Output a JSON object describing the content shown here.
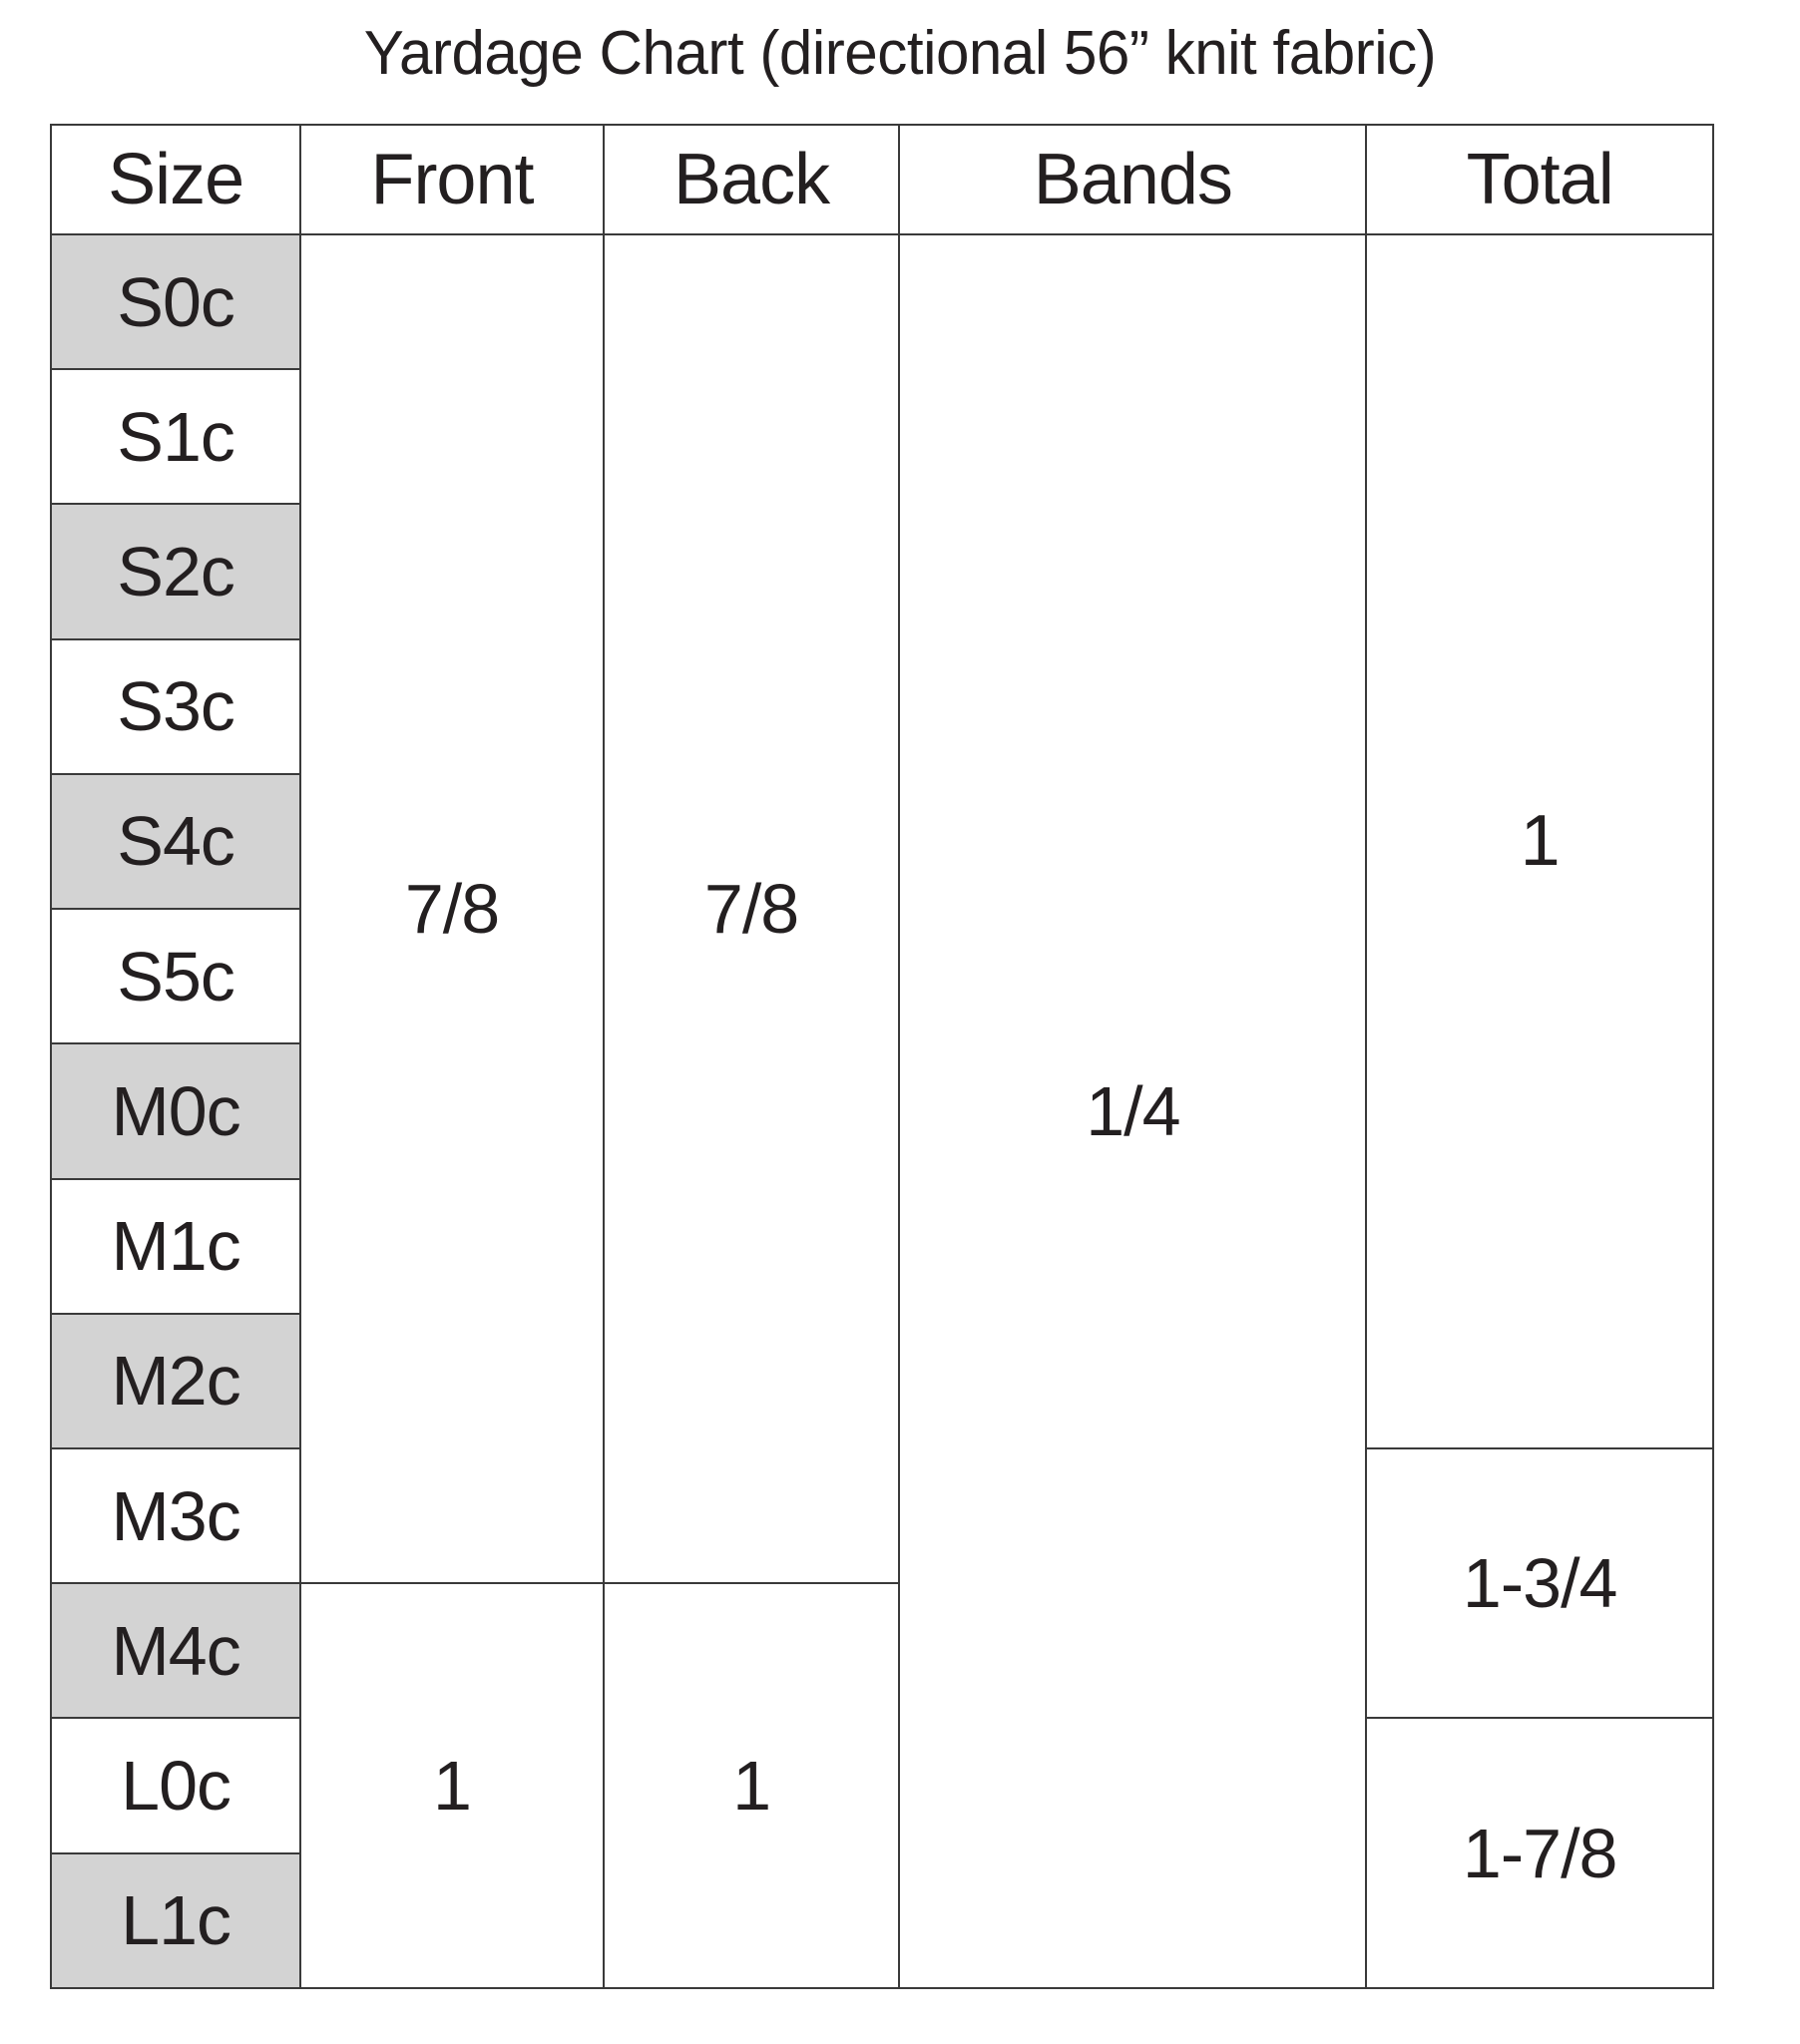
{
  "title": "Yardage Chart (directional 56” knit fabric)",
  "chart_data": {
    "type": "table",
    "title": "Yardage Chart (directional 56” knit fabric)",
    "columns": [
      "Size",
      "Front",
      "Back",
      "Bands",
      "Total"
    ],
    "categories": [
      "S0c",
      "S1c",
      "S2c",
      "S3c",
      "S4c",
      "S5c",
      "M0c",
      "M1c",
      "M2c",
      "M3c",
      "M4c",
      "L0c",
      "L1c"
    ],
    "rows": [
      {
        "size": "S0c",
        "front": "7/8",
        "back": "7/8",
        "bands": "1/4",
        "total": "1"
      },
      {
        "size": "S1c",
        "front": "7/8",
        "back": "7/8",
        "bands": "1/4",
        "total": "1"
      },
      {
        "size": "S2c",
        "front": "7/8",
        "back": "7/8",
        "bands": "1/4",
        "total": "1"
      },
      {
        "size": "S3c",
        "front": "7/8",
        "back": "7/8",
        "bands": "1/4",
        "total": "1"
      },
      {
        "size": "S4c",
        "front": "7/8",
        "back": "7/8",
        "bands": "1/4",
        "total": "1"
      },
      {
        "size": "S5c",
        "front": "7/8",
        "back": "7/8",
        "bands": "1/4",
        "total": "1"
      },
      {
        "size": "M0c",
        "front": "7/8",
        "back": "7/8",
        "bands": "1/4",
        "total": "1"
      },
      {
        "size": "M1c",
        "front": "7/8",
        "back": "7/8",
        "bands": "1/4",
        "total": "1"
      },
      {
        "size": "M2c",
        "front": "7/8",
        "back": "7/8",
        "bands": "1/4",
        "total": "1"
      },
      {
        "size": "M3c",
        "front": "7/8",
        "back": "7/8",
        "bands": "1/4",
        "total": "1-3/4"
      },
      {
        "size": "M4c",
        "front": "1",
        "back": "1",
        "bands": "1/4",
        "total": "1-3/4"
      },
      {
        "size": "L0c",
        "front": "1",
        "back": "1",
        "bands": "1/4",
        "total": "1-7/8"
      },
      {
        "size": "L1c",
        "front": "1",
        "back": "1",
        "bands": "1/4",
        "total": "1-7/8"
      }
    ],
    "merged_values": {
      "front": [
        {
          "value": "7/8",
          "span_rows": [
            "S0c",
            "M3c"
          ]
        },
        {
          "value": "1",
          "span_rows": [
            "M4c",
            "L1c"
          ]
        }
      ],
      "back": [
        {
          "value": "7/8",
          "span_rows": [
            "S0c",
            "M3c"
          ]
        },
        {
          "value": "1",
          "span_rows": [
            "M4c",
            "L1c"
          ]
        }
      ],
      "bands": [
        {
          "value": "1/4",
          "span_rows": [
            "S0c",
            "L1c"
          ]
        }
      ],
      "total": [
        {
          "value": "1",
          "span_rows": [
            "S0c",
            "M2c"
          ]
        },
        {
          "value": "1-3/4",
          "span_rows": [
            "M3c",
            "M4c"
          ]
        },
        {
          "value": "1-7/8",
          "span_rows": [
            "L0c",
            "L1c"
          ]
        }
      ]
    }
  },
  "header": {
    "size": "Size",
    "front": "Front",
    "back": "Back",
    "bands": "Bands",
    "total": "Total"
  },
  "sizes": [
    {
      "label": "S0c",
      "shaded": true
    },
    {
      "label": "S1c",
      "shaded": false
    },
    {
      "label": "S2c",
      "shaded": true
    },
    {
      "label": "S3c",
      "shaded": false
    },
    {
      "label": "S4c",
      "shaded": true
    },
    {
      "label": "S5c",
      "shaded": false
    },
    {
      "label": "M0c",
      "shaded": true
    },
    {
      "label": "M1c",
      "shaded": false
    },
    {
      "label": "M2c",
      "shaded": true
    },
    {
      "label": "M3c",
      "shaded": false
    },
    {
      "label": "M4c",
      "shaded": true
    },
    {
      "label": "L0c",
      "shaded": false
    },
    {
      "label": "L1c",
      "shaded": true
    }
  ],
  "values": {
    "front_upper": "7/8",
    "front_lower": "1",
    "back_upper": "7/8",
    "back_lower": "1",
    "bands_all": "1/4",
    "total_upper": "1",
    "total_middle": "1-3/4",
    "total_lower": "1-7/8"
  },
  "colors": {
    "shaded_row": "#d3d3d3",
    "plain_row": "#ffffff",
    "border": "#3a3a3a",
    "text": "#231f20"
  }
}
